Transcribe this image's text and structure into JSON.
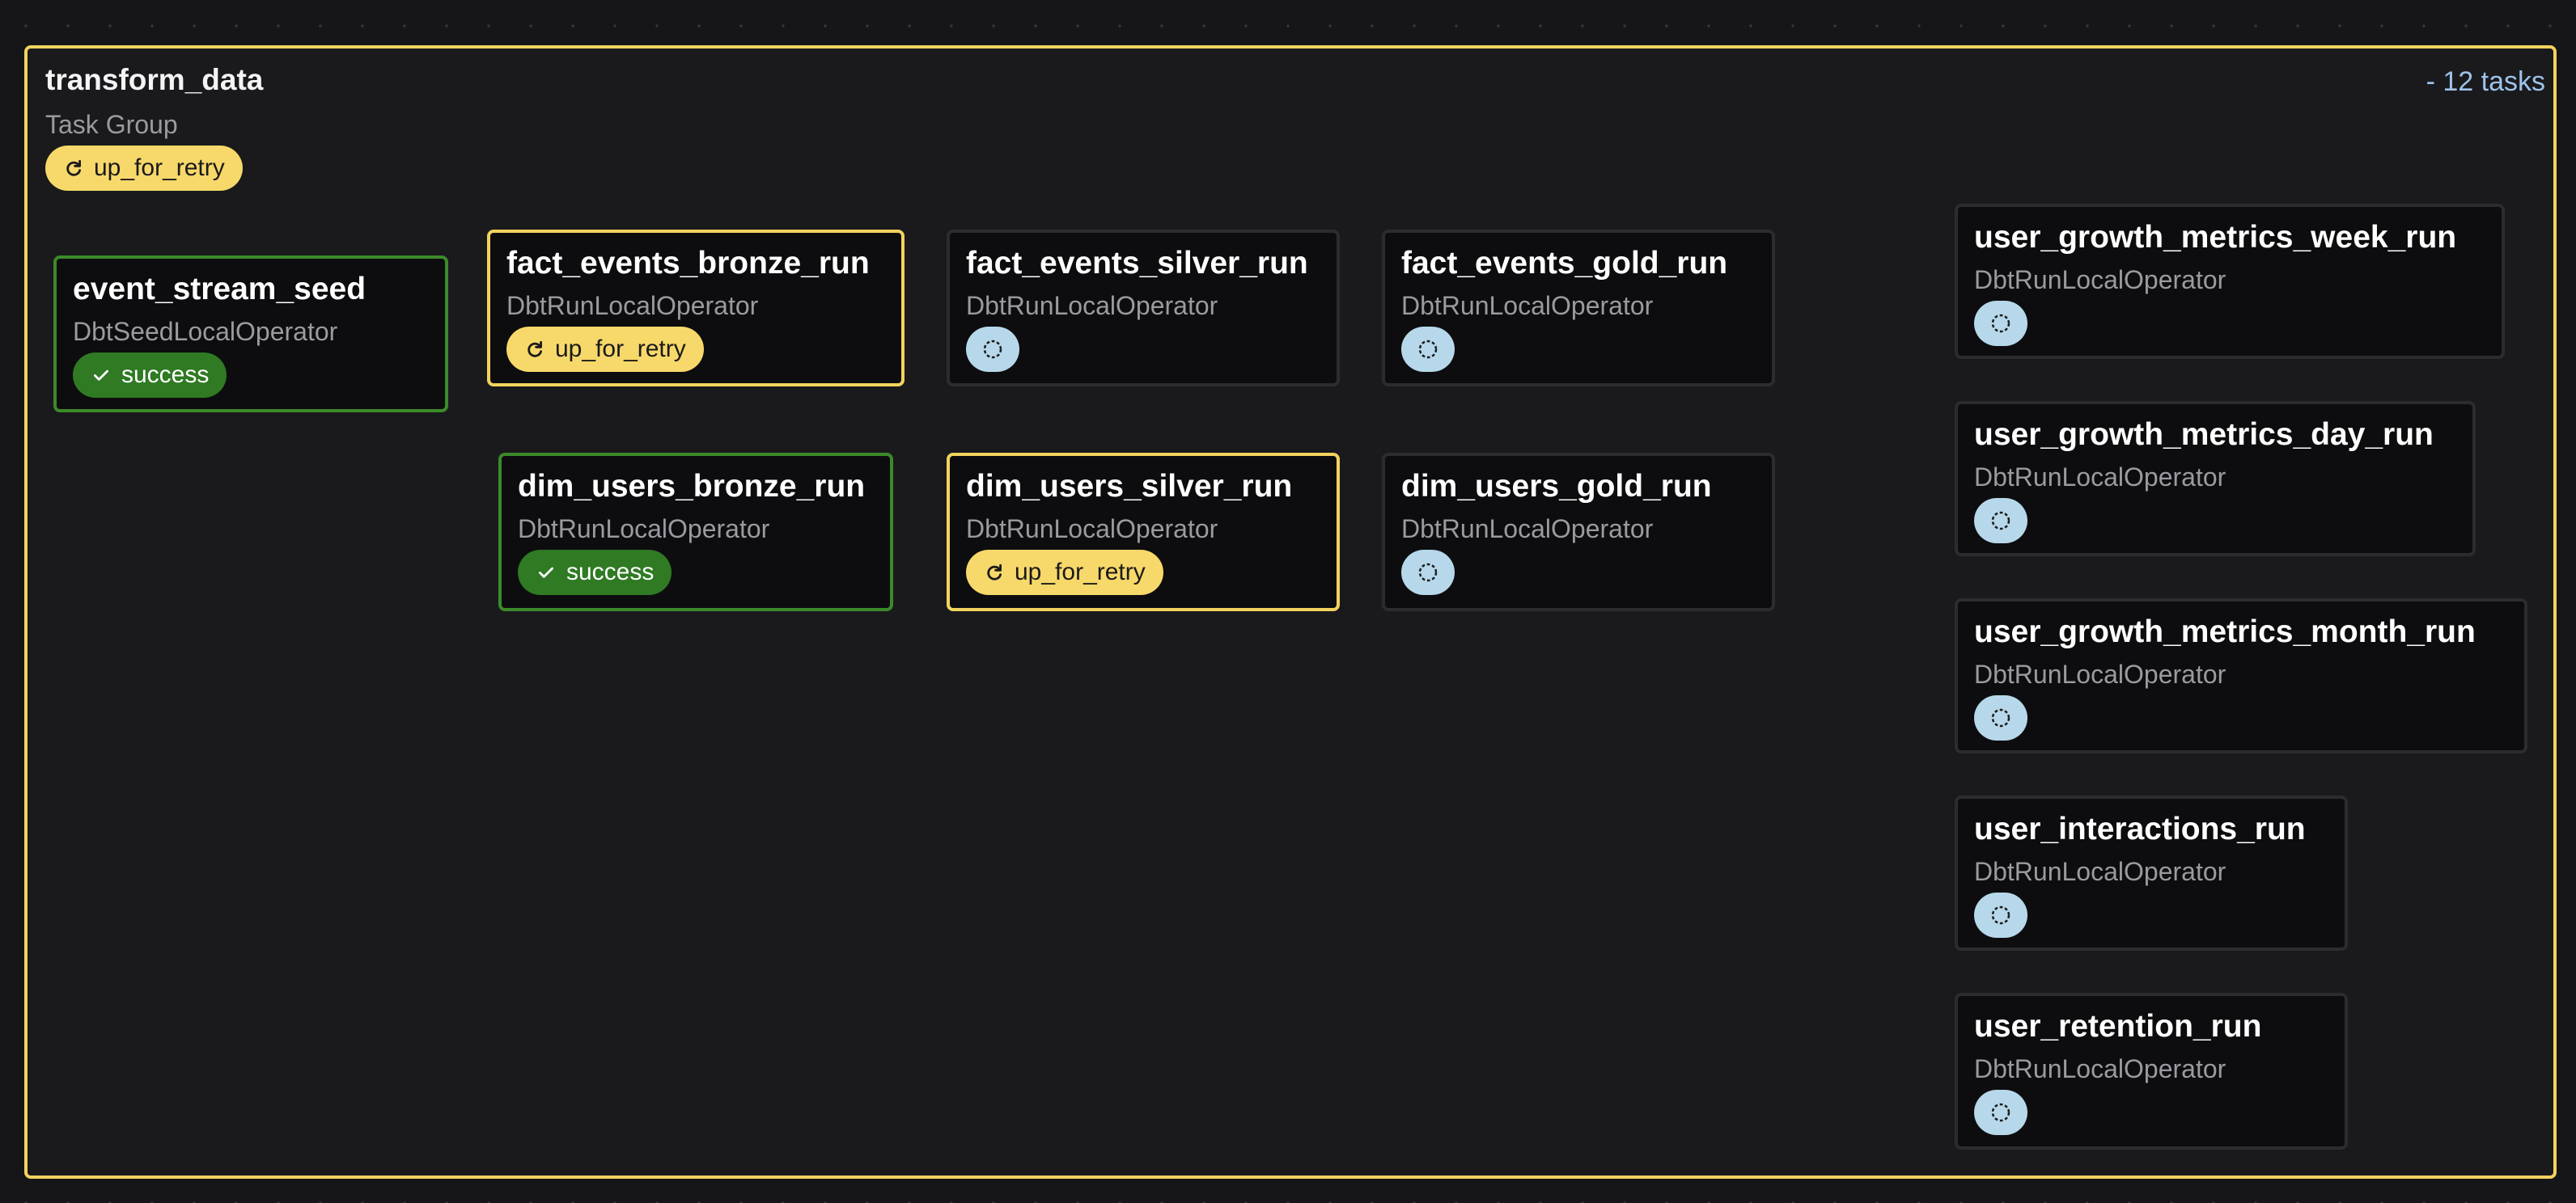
{
  "group": {
    "title": "transform_data",
    "subtitle": "Task Group",
    "count": "- 12 tasks",
    "state": "up_for_retry",
    "colors": {
      "retry": "#f7d86a",
      "success": "#2f7a23",
      "none": "#b6d8ea",
      "border_retry": "#f2d35e",
      "border_success": "#3c8a2a"
    }
  },
  "nodes": [
    {
      "id": "event_stream_seed",
      "title": "event_stream_seed",
      "operator": "DbtSeedLocalOperator",
      "state": "success"
    },
    {
      "id": "fact_events_bronze_run",
      "title": "fact_events_bronze_run",
      "operator": "DbtRunLocalOperator",
      "state": "up_for_retry"
    },
    {
      "id": "fact_events_silver_run",
      "title": "fact_events_silver_run",
      "operator": "DbtRunLocalOperator",
      "state": ""
    },
    {
      "id": "fact_events_gold_run",
      "title": "fact_events_gold_run",
      "operator": "DbtRunLocalOperator",
      "state": ""
    },
    {
      "id": "dim_users_bronze_run",
      "title": "dim_users_bronze_run",
      "operator": "DbtRunLocalOperator",
      "state": "success"
    },
    {
      "id": "dim_users_silver_run",
      "title": "dim_users_silver_run",
      "operator": "DbtRunLocalOperator",
      "state": "up_for_retry"
    },
    {
      "id": "dim_users_gold_run",
      "title": "dim_users_gold_run",
      "operator": "DbtRunLocalOperator",
      "state": ""
    },
    {
      "id": "user_growth_metrics_week_run",
      "title": "user_growth_metrics_week_run",
      "operator": "DbtRunLocalOperator",
      "state": ""
    },
    {
      "id": "user_growth_metrics_day_run",
      "title": "user_growth_metrics_day_run",
      "operator": "DbtRunLocalOperator",
      "state": ""
    },
    {
      "id": "user_growth_metrics_month_run",
      "title": "user_growth_metrics_month_run",
      "operator": "DbtRunLocalOperator",
      "state": ""
    },
    {
      "id": "user_interactions_run",
      "title": "user_interactions_run",
      "operator": "DbtRunLocalOperator",
      "state": ""
    },
    {
      "id": "user_retention_run",
      "title": "user_retention_run",
      "operator": "DbtRunLocalOperator",
      "state": ""
    }
  ],
  "edges": [
    [
      "event_stream_seed",
      "fact_events_bronze_run"
    ],
    [
      "event_stream_seed",
      "dim_users_bronze_run"
    ],
    [
      "fact_events_bronze_run",
      "fact_events_silver_run"
    ],
    [
      "fact_events_silver_run",
      "fact_events_gold_run"
    ],
    [
      "dim_users_bronze_run",
      "dim_users_silver_run"
    ],
    [
      "dim_users_silver_run",
      "dim_users_gold_run"
    ],
    [
      "fact_events_gold_run",
      "user_growth_metrics_week_run"
    ],
    [
      "fact_events_gold_run",
      "user_growth_metrics_day_run"
    ],
    [
      "fact_events_gold_run",
      "user_growth_metrics_month_run"
    ],
    [
      "fact_events_gold_run",
      "user_interactions_run"
    ],
    [
      "fact_events_gold_run",
      "user_retention_run"
    ],
    [
      "dim_users_gold_run",
      "user_growth_metrics_week_run"
    ],
    [
      "dim_users_gold_run",
      "user_growth_metrics_day_run"
    ],
    [
      "dim_users_gold_run",
      "user_growth_metrics_month_run"
    ],
    [
      "dim_users_gold_run",
      "user_interactions_run"
    ],
    [
      "dim_users_gold_run",
      "user_retention_run"
    ]
  ]
}
